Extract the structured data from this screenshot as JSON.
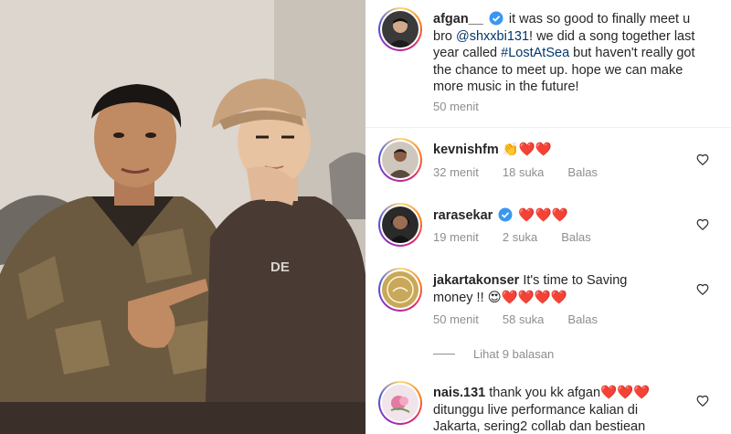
{
  "post": {
    "author": "afgan__",
    "caption_before": "it was so good to finally meet u bro",
    "mention": "@shxxbi131",
    "caption_middle": "! we did a song together last year called",
    "hashtag": "#LostAtSea",
    "caption_after": "but haven't really got the chance to meet up. hope we can make more music in the future!",
    "time": "50 menit",
    "verified_icon": "verified-badge"
  },
  "comments": [
    {
      "user": "kevnishfm",
      "verified": false,
      "text": "",
      "emoji": "👏❤️❤️",
      "time": "32 menit",
      "likes": "18 suka",
      "reply_label": "Balas"
    },
    {
      "user": "rarasekar",
      "verified": true,
      "text": "",
      "emoji": "❤️❤️❤️",
      "time": "19 menit",
      "likes": "2 suka",
      "reply_label": "Balas"
    },
    {
      "user": "jakartakonser",
      "verified": false,
      "text": "It's time to Saving money !!",
      "emoji": "😍❤️❤️❤️❤️",
      "time": "50 menit",
      "likes": "58 suka",
      "reply_label": "Balas",
      "view_replies": "Lihat 9 balasan"
    },
    {
      "user": "nais.131",
      "verified": false,
      "text_line1": "thank you kk afgan",
      "emoji": "❤️❤️❤️",
      "text_line2": "ditunggu live performance kalian di",
      "text_line3": "Jakarta, sering2 collab dan bestiean"
    }
  ],
  "photo": {
    "shirt_text": "DE"
  },
  "colors": {
    "link": "#00376b",
    "muted": "#8e8e8e",
    "verified": "#3897f0",
    "heart": "#ed1c24"
  }
}
